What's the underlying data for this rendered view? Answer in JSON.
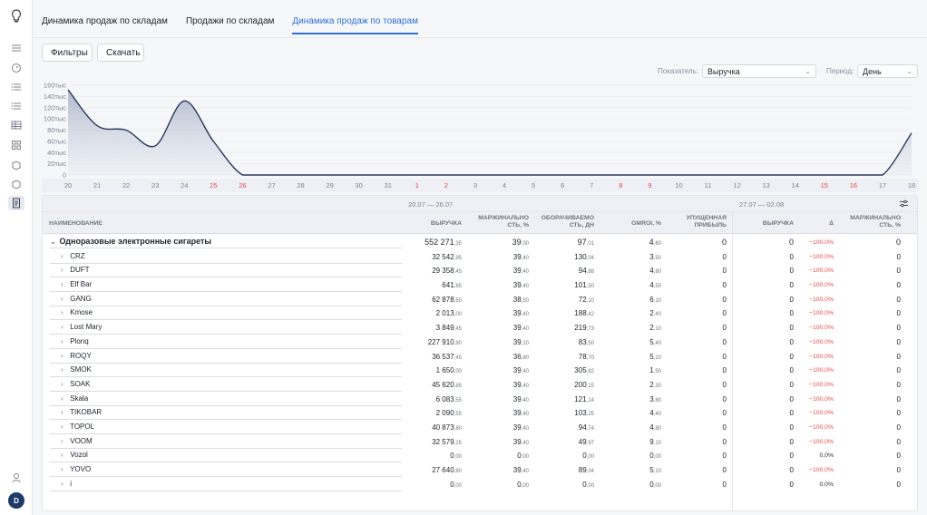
{
  "sidebar": {
    "avatar_letter": "D"
  },
  "tabs": [
    {
      "label": "Динамика продаж по складам"
    },
    {
      "label": "Продажи по складам"
    },
    {
      "label": "Динамика продаж по товарам"
    }
  ],
  "toolbar": {
    "filters_label": "Фильтры",
    "download_label": "Скачать"
  },
  "controls": {
    "indicator_label": "Показатель:",
    "indicator_value": "Выручка",
    "period_label": "Период:",
    "period_value": "День"
  },
  "chart_data": {
    "type": "area",
    "yticks": [
      "160тыс",
      "140тыс",
      "120тыс",
      "100тыс",
      "80тыс",
      "60тыс",
      "40тыс",
      "20тыс",
      "0"
    ],
    "ylim": [
      0,
      160000
    ],
    "x": [
      "20",
      "21",
      "22",
      "23",
      "24",
      "25",
      "26",
      "27",
      "28",
      "29",
      "30",
      "31",
      "1",
      "2",
      "3",
      "4",
      "5",
      "6",
      "7",
      "8",
      "9",
      "10",
      "11",
      "12",
      "13",
      "14",
      "15",
      "16",
      "17",
      "18"
    ],
    "red_ticks": [
      "25",
      "26",
      "1",
      "2",
      "8",
      "9",
      "15",
      "16"
    ],
    "values": [
      152000,
      88000,
      80000,
      52000,
      132000,
      60000,
      0,
      0,
      0,
      0,
      0,
      0,
      0,
      0,
      0,
      0,
      0,
      0,
      0,
      0,
      0,
      0,
      0,
      0,
      0,
      0,
      0,
      0,
      0,
      75000
    ],
    "color": "#2b3a5c"
  },
  "table": {
    "period1": "20.07 — 26.07",
    "period2": "27.07 — 02.08",
    "headers": {
      "name": "Наименование",
      "revenue": "Выручка",
      "margin": "Маржинально сть, %",
      "turnover": "Оборачиваемо сть, дн",
      "gmroi": "GMROI, %",
      "lost": "Упущенная прибыль",
      "revenue2": "Выручка",
      "delta": "Δ",
      "margin2": "Маржинально сть, %"
    },
    "rows": [
      {
        "name": "Одноразовые электронные сигареты",
        "rev": "552 271",
        "rev_c": ",35",
        "mar": "39",
        "mar_c": ",00",
        "tur": "97",
        "tur_c": ",01",
        "gm": "4",
        "gm_c": ",60",
        "lost": "0",
        "rev2": "0",
        "delta": "−100,0%",
        "mar2": "0"
      },
      {
        "name": "CRZ",
        "rev": "32 542",
        "rev_c": ",95",
        "mar": "39",
        "mar_c": ",40",
        "tur": "130",
        "tur_c": ",04",
        "gm": "3",
        "gm_c": ",50",
        "lost": "0",
        "rev2": "0",
        "delta": "−100,0%",
        "mar2": "0"
      },
      {
        "name": "DUFT",
        "rev": "29 358",
        "rev_c": ",45",
        "mar": "39",
        "mar_c": ",40",
        "tur": "94",
        "tur_c": ",88",
        "gm": "4",
        "gm_c": ",80",
        "lost": "0",
        "rev2": "0",
        "delta": "−100,0%",
        "mar2": "0"
      },
      {
        "name": "Elf Bar",
        "rev": "641",
        "rev_c": ",85",
        "mar": "39",
        "mar_c": ",40",
        "tur": "101",
        "tur_c": ",50",
        "gm": "4",
        "gm_c": ",50",
        "lost": "0",
        "rev2": "0",
        "delta": "−100,0%",
        "mar2": "0"
      },
      {
        "name": "GANG",
        "rev": "62 878",
        "rev_c": ",50",
        "mar": "38",
        "mar_c": ",50",
        "tur": "72",
        "tur_c": ",10",
        "gm": "6",
        "gm_c": ",10",
        "lost": "0",
        "rev2": "0",
        "delta": "−100,0%",
        "mar2": "0"
      },
      {
        "name": "Kmose",
        "rev": "2 013",
        "rev_c": ",00",
        "mar": "39",
        "mar_c": ",40",
        "tur": "188",
        "tur_c": ",42",
        "gm": "2",
        "gm_c": ",40",
        "lost": "0",
        "rev2": "0",
        "delta": "−100,0%",
        "mar2": "0"
      },
      {
        "name": "Lost Mary",
        "rev": "3 849",
        "rev_c": ",45",
        "mar": "39",
        "mar_c": ",40",
        "tur": "219",
        "tur_c": ",73",
        "gm": "2",
        "gm_c": ",10",
        "lost": "0",
        "rev2": "0",
        "delta": "−100,0%",
        "mar2": "0"
      },
      {
        "name": "Plonq",
        "rev": "227 910",
        "rev_c": ",90",
        "mar": "39",
        "mar_c": ",10",
        "tur": "83",
        "tur_c": ",50",
        "gm": "5",
        "gm_c": ",40",
        "lost": "0",
        "rev2": "0",
        "delta": "−100,0%",
        "mar2": "0"
      },
      {
        "name": "ROQY",
        "rev": "36 537",
        "rev_c": ",45",
        "mar": "36",
        "mar_c": ",80",
        "tur": "78",
        "tur_c": ",70",
        "gm": "5",
        "gm_c": ",20",
        "lost": "0",
        "rev2": "0",
        "delta": "−100,0%",
        "mar2": "0"
      },
      {
        "name": "SMOK",
        "rev": "1 650",
        "rev_c": ",00",
        "mar": "39",
        "mar_c": ",40",
        "tur": "305",
        "tur_c": ",82",
        "gm": "1",
        "gm_c": ",50",
        "lost": "0",
        "rev2": "0",
        "delta": "−100,0%",
        "mar2": "0"
      },
      {
        "name": "SOAK",
        "rev": "45 620",
        "rev_c": ",85",
        "mar": "39",
        "mar_c": ",40",
        "tur": "200",
        "tur_c": ",15",
        "gm": "2",
        "gm_c": ",30",
        "lost": "0",
        "rev2": "0",
        "delta": "−100,0%",
        "mar2": "0"
      },
      {
        "name": "Skala",
        "rev": "6 083",
        "rev_c": ",55",
        "mar": "39",
        "mar_c": ",40",
        "tur": "121",
        "tur_c": ",14",
        "gm": "3",
        "gm_c": ",80",
        "lost": "0",
        "rev2": "0",
        "delta": "−100,0%",
        "mar2": "0"
      },
      {
        "name": "TIKOBAR",
        "rev": "2 090",
        "rev_c": ",55",
        "mar": "39",
        "mar_c": ",40",
        "tur": "103",
        "tur_c": ",25",
        "gm": "4",
        "gm_c": ",40",
        "lost": "0",
        "rev2": "0",
        "delta": "−100,0%",
        "mar2": "0"
      },
      {
        "name": "TOPOL",
        "rev": "40 873",
        "rev_c": ",80",
        "mar": "39",
        "mar_c": ",40",
        "tur": "94",
        "tur_c": ",74",
        "gm": "4",
        "gm_c": ",80",
        "lost": "0",
        "rev2": "0",
        "delta": "−100,0%",
        "mar2": "0"
      },
      {
        "name": "VOOM",
        "rev": "32 579",
        "rev_c": ",25",
        "mar": "39",
        "mar_c": ",40",
        "tur": "49",
        "tur_c": ",97",
        "gm": "9",
        "gm_c": ",10",
        "lost": "0",
        "rev2": "0",
        "delta": "−100,0%",
        "mar2": "0"
      },
      {
        "name": "Vozol",
        "rev": "0",
        "rev_c": ",00",
        "mar": "0",
        "mar_c": ",00",
        "tur": "0",
        "tur_c": ",00",
        "gm": "0",
        "gm_c": ",00",
        "lost": "0",
        "rev2": "0",
        "delta": "0,0%",
        "mar2": "0"
      },
      {
        "name": "YOVO",
        "rev": "27 640",
        "rev_c": ",80",
        "mar": "39",
        "mar_c": ",40",
        "tur": "89",
        "tur_c": ",04",
        "gm": "5",
        "gm_c": ",10",
        "lost": "0",
        "rev2": "0",
        "delta": "−100,0%",
        "mar2": "0"
      },
      {
        "name": "i",
        "rev": "0",
        "rev_c": ",00",
        "mar": "0",
        "mar_c": ",00",
        "tur": "0",
        "tur_c": ",00",
        "gm": "0",
        "gm_c": ",00",
        "lost": "0",
        "rev2": "0",
        "delta": "0,0%",
        "mar2": "0"
      }
    ]
  }
}
